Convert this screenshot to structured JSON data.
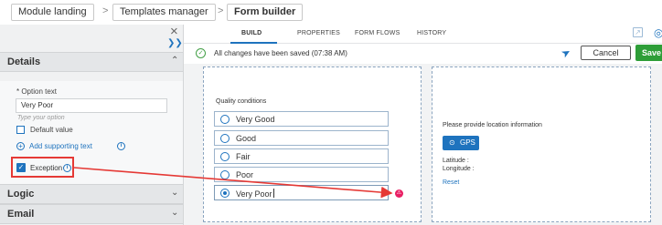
{
  "breadcrumb": {
    "items": [
      "Module landing",
      "Templates manager",
      "Form builder"
    ],
    "separator": ">"
  },
  "left_panel": {
    "close_glyph": "×",
    "collapse_glyph": "»",
    "sections": {
      "details": "Details",
      "logic": "Logic",
      "email": "Email"
    },
    "option_text_label": "* Option text",
    "option_text_value": "Very Poor",
    "option_text_hint": "Type your option",
    "default_value_label": "Default value",
    "add_supporting_text": "Add supporting text",
    "exception_label": "Exception",
    "exception_checked": true
  },
  "tabs": {
    "items": [
      "BUILD",
      "PROPERTIES",
      "FORM FLOWS",
      "HISTORY"
    ],
    "active": "BUILD"
  },
  "status_bar": {
    "message": "All changes have been saved (07:38 AM)",
    "cancel_label": "Cancel",
    "save_label": "Save"
  },
  "question": {
    "label": "Quality conditions",
    "options": [
      "Very Good",
      "Good",
      "Fair",
      "Poor",
      "Very Poor"
    ],
    "selected": "Very Poor"
  },
  "location": {
    "prompt": "Please provide location information",
    "gps_label": "GPS",
    "latitude_label": "Latitude :",
    "longitude_label": "Longitude :",
    "reset_label": "Reset"
  },
  "icons": {
    "close": "close-icon",
    "collapse": "double-chevron-icon",
    "info": "info-icon",
    "add": "plus-circle-icon",
    "saved": "check-circle-icon",
    "navigate": "navigation-arrow-icon",
    "external": "external-link-icon",
    "globe": "globe-icon",
    "exception_marker": "exception-marker-icon"
  },
  "colors": {
    "accent": "#1e73be",
    "save": "#2e9e38",
    "annotation": "#e53935",
    "marker": "#e91e63"
  }
}
